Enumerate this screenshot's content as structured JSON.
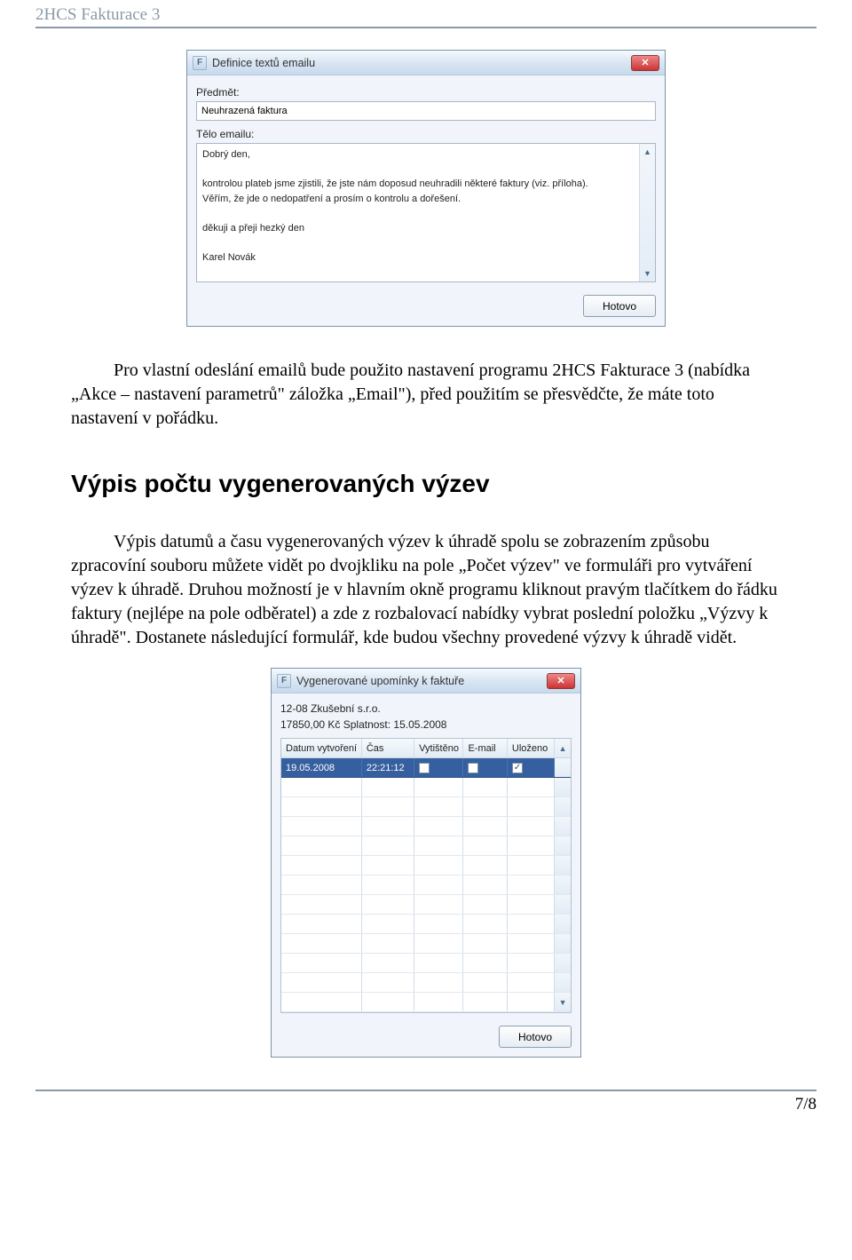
{
  "doc": {
    "header_title": "2HCS Fakturace 3",
    "page_number": "7/8"
  },
  "dialog1": {
    "app_icon_letter": "F",
    "title": "Definice textů emailu",
    "subject_label": "Předmět:",
    "subject_value": "Neuhrazená faktura",
    "body_label": "Tělo emailu:",
    "body_value": "Dobrý den,\n\nkontrolou plateb jsme zjistili, že jste nám doposud neuhradili některé faktury (viz. příloha).\nVěřím, že jde o nedopatření a prosím o kontrolu a dořešení.\n\nděkuji a přeji hezký den\n\nKarel Novák",
    "done_button": "Hotovo"
  },
  "para1": "Pro vlastní odeslání emailů bude použito nastavení programu 2HCS Fakturace 3 (nabídka „Akce – nastavení parametrů\" záložka „Email\"), před použitím se přesvědčte, že máte toto nastavení v pořádku.",
  "section_heading": "Výpis počtu vygenerovaných výzev",
  "para2": "Výpis datumů a času vygenerovaných výzev k úhradě spolu se zobrazením způsobu zpracovíní souboru můžete vidět po dvojkliku na pole „Počet výzev\" ve formuláři pro vytváření výzev k úhradě. Druhou možností je v hlavním okně programu kliknout pravým tlačítkem do řádku faktury (nejlépe na pole odběratel) a zde z rozbalovací nabídky vybrat poslední položku  „Výzvy k úhradě\". Dostanete následující formulář, kde budou všechny provedené výzvy k úhradě vidět.",
  "dialog2": {
    "app_icon_letter": "F",
    "title": "Vygenerované upomínky k faktuře",
    "info_line1": "12-08 Zkušební s.r.o.",
    "info_line2": "17850,00 Kč Splatnost: 15.05.2008",
    "columns": {
      "date": "Datum vytvoření",
      "time": "Čas",
      "printed": "Vytištěno",
      "email": "E-mail",
      "saved": "Uloženo"
    },
    "row1": {
      "date": "19.05.2008",
      "time": "22:21:12",
      "printed_checked": false,
      "email_checked": false,
      "saved_checked": true
    },
    "empty_row_count": 12,
    "done_button": "Hotovo"
  }
}
